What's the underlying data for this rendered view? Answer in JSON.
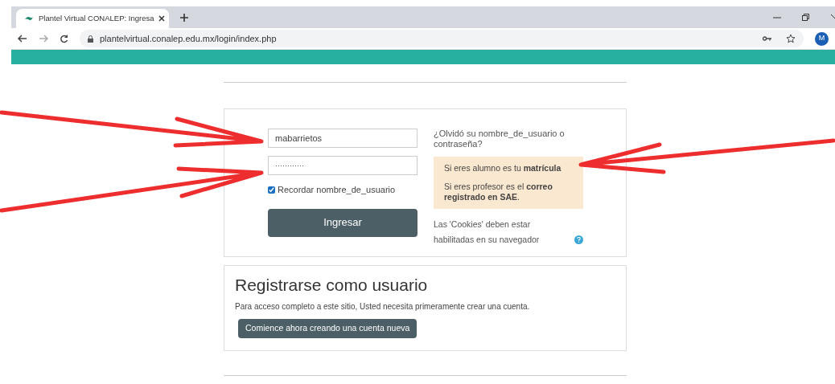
{
  "browser": {
    "tab_title": "Plantel Virtual CONALEP: Ingresa",
    "url": "plantelvirtual.conalep.edu.mx/login/index.php",
    "profile_initial": "M"
  },
  "login": {
    "username": "mabarrietos",
    "password": "············",
    "remember_label": "Recordar nombre_de_usuario",
    "remember_checked": true,
    "submit": "Ingresar",
    "forgot_link": "¿Olvidó su nombre_de_usuario o contraseña?",
    "notice": [
      "Si eres alumno es tu **matrícula**",
      "Si eres profesor es el **correo registrado en SAE**."
    ],
    "cookies_note": "Las 'Cookies' deben estar habilitadas en su navegador"
  },
  "register": {
    "title": "Registrarse como usuario",
    "text": "Para acceso completo a este sitio, Usted necesita primeramente crear una cuenta.",
    "button": "Comience ahora creando una cuenta nueva"
  }
}
